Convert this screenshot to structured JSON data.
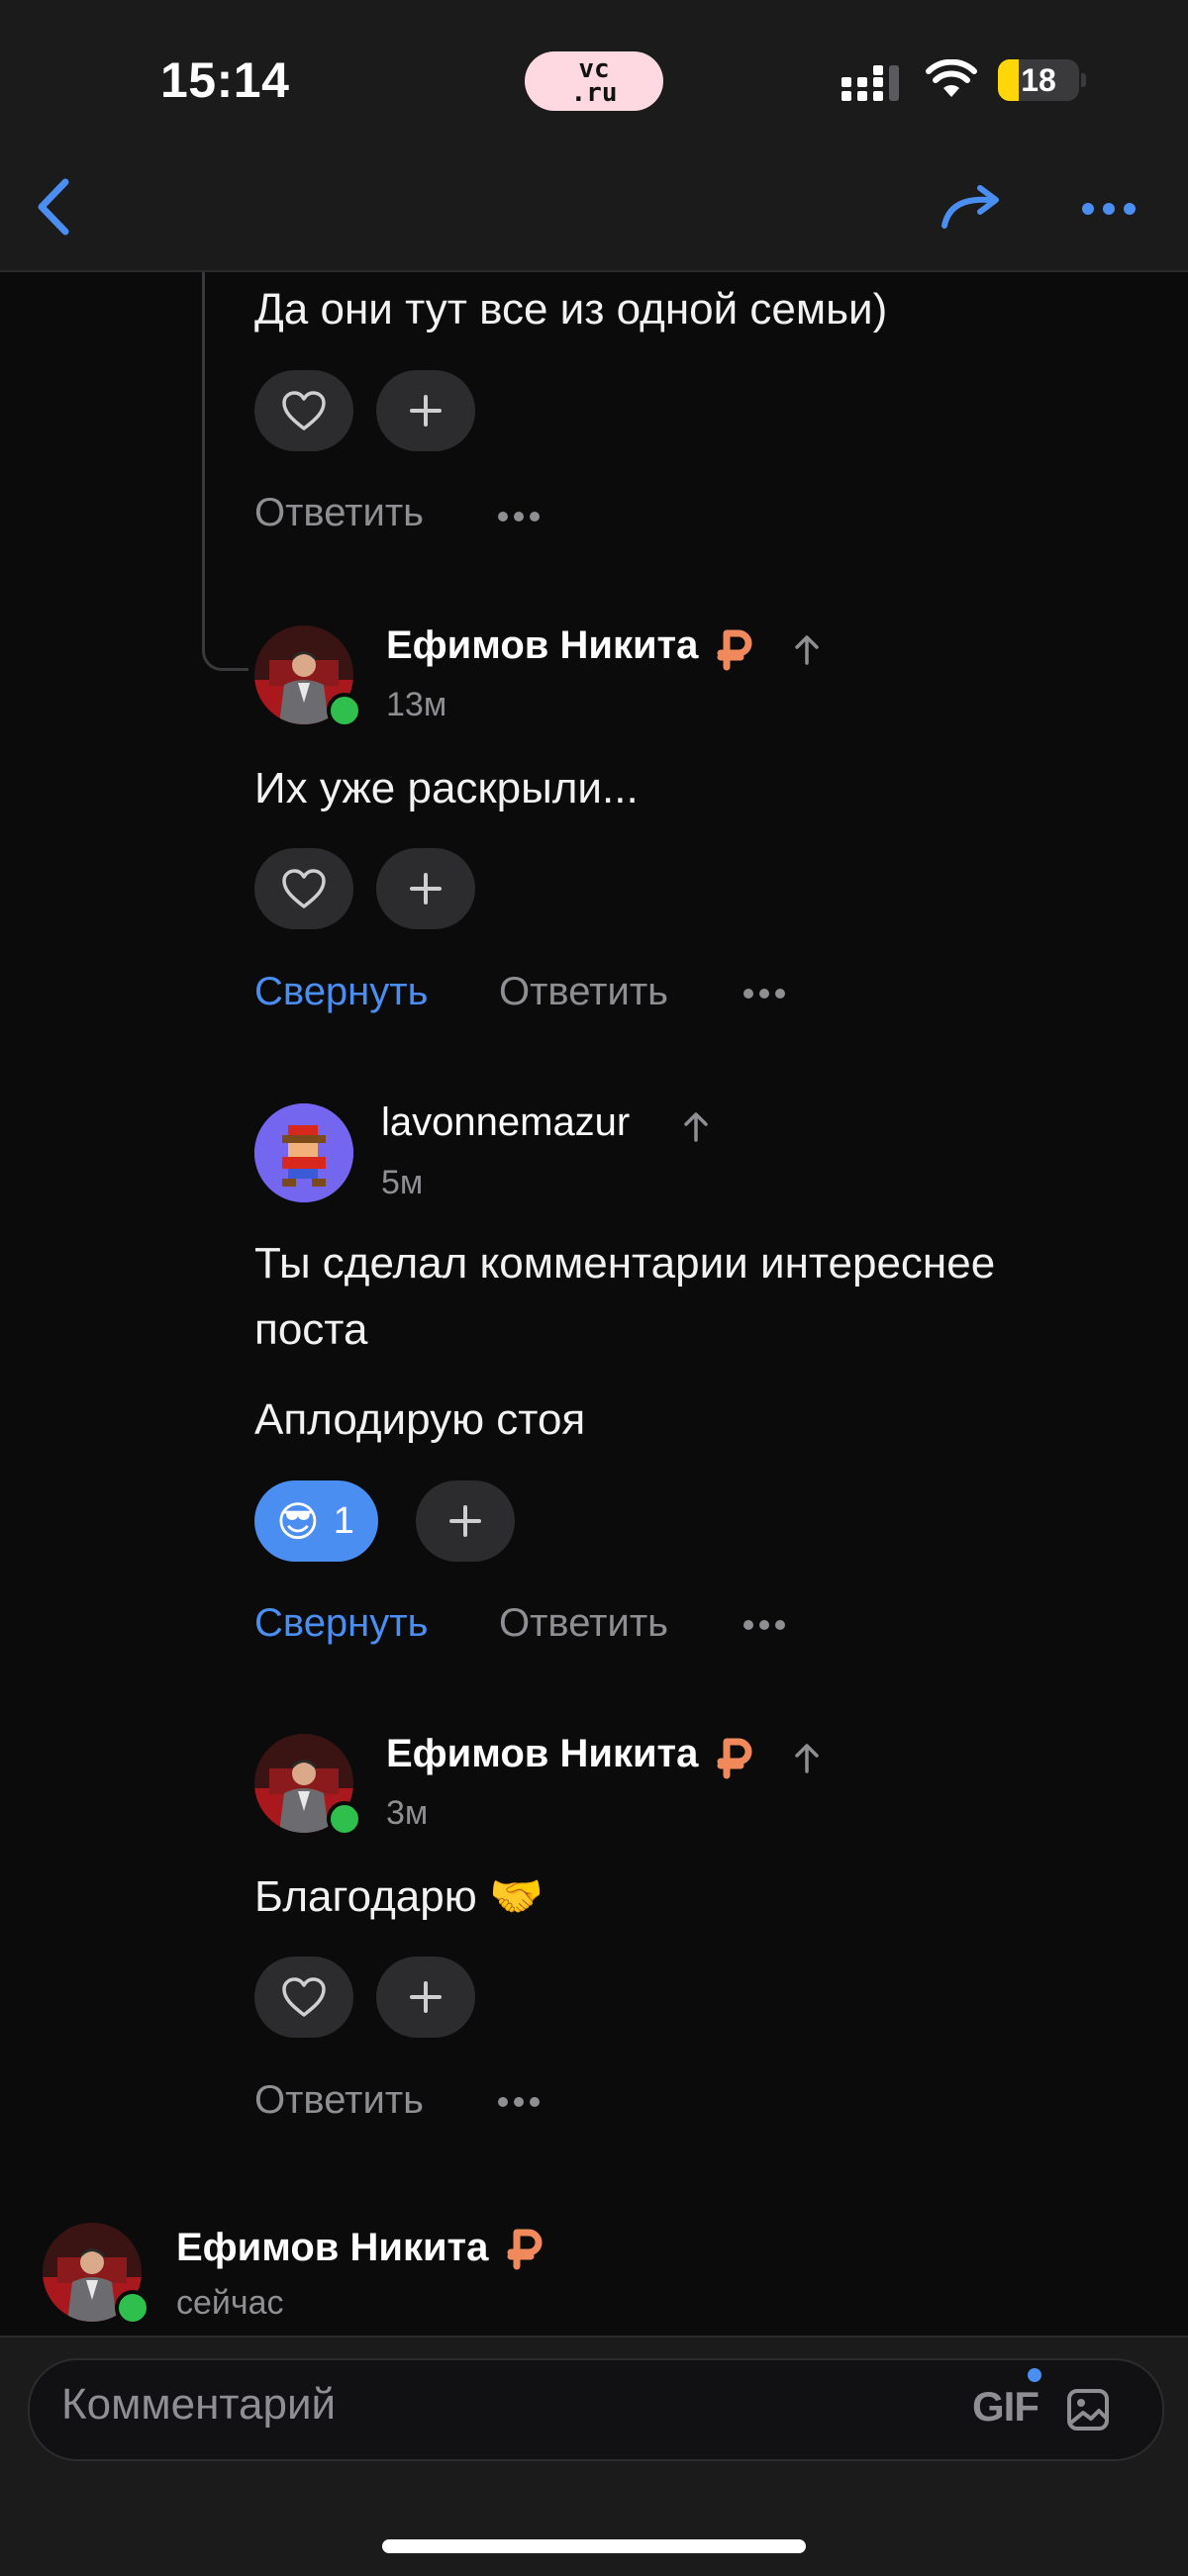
{
  "status_bar": {
    "time": "15:14",
    "site_badge": "vc\n.ru",
    "battery": "18",
    "battery_fraction": 0.18
  },
  "nav": {
    "back_icon": "chevron-left-icon",
    "share_icon": "share-arrow-icon",
    "more_icon": "more-dots-icon",
    "accent": "#4a8ef2"
  },
  "comments": [
    {
      "text": "Да они тут все из одной семьи)",
      "actions": {
        "reply": "Ответить"
      }
    },
    {
      "author": "Ефимов Никита",
      "badge_icon": "ruble-badge-icon",
      "time": "13м",
      "text": "Их уже раскрыли...",
      "actions": {
        "collapse": "Свернуть",
        "reply": "Ответить"
      }
    },
    {
      "author": "lavonnemazur",
      "time": "5м",
      "text_lines": [
        "Ты сделал комментарии интереснее",
        "поста"
      ],
      "text2": "Аплодирую стоя",
      "reaction": {
        "emoji": "😎",
        "count": "1"
      },
      "actions": {
        "collapse": "Свернуть",
        "reply": "Ответить"
      }
    },
    {
      "author": "Ефимов Никита",
      "badge_icon": "ruble-badge-icon",
      "time": "3м",
      "text": "Благодарю",
      "emoji": "🤝",
      "actions": {
        "reply": "Ответить"
      }
    },
    {
      "author": "Ефимов Никита",
      "badge_icon": "ruble-badge-icon",
      "time": "сейчас"
    }
  ],
  "composer": {
    "placeholder": "Комментарий",
    "gif_label": "GIF"
  },
  "colors": {
    "background": "#0b0b0b",
    "panel": "#1b1b1c",
    "accent_blue": "#4a8ef2",
    "ruble_orange": "#f08a5d",
    "online_green": "#2fbf4d"
  }
}
